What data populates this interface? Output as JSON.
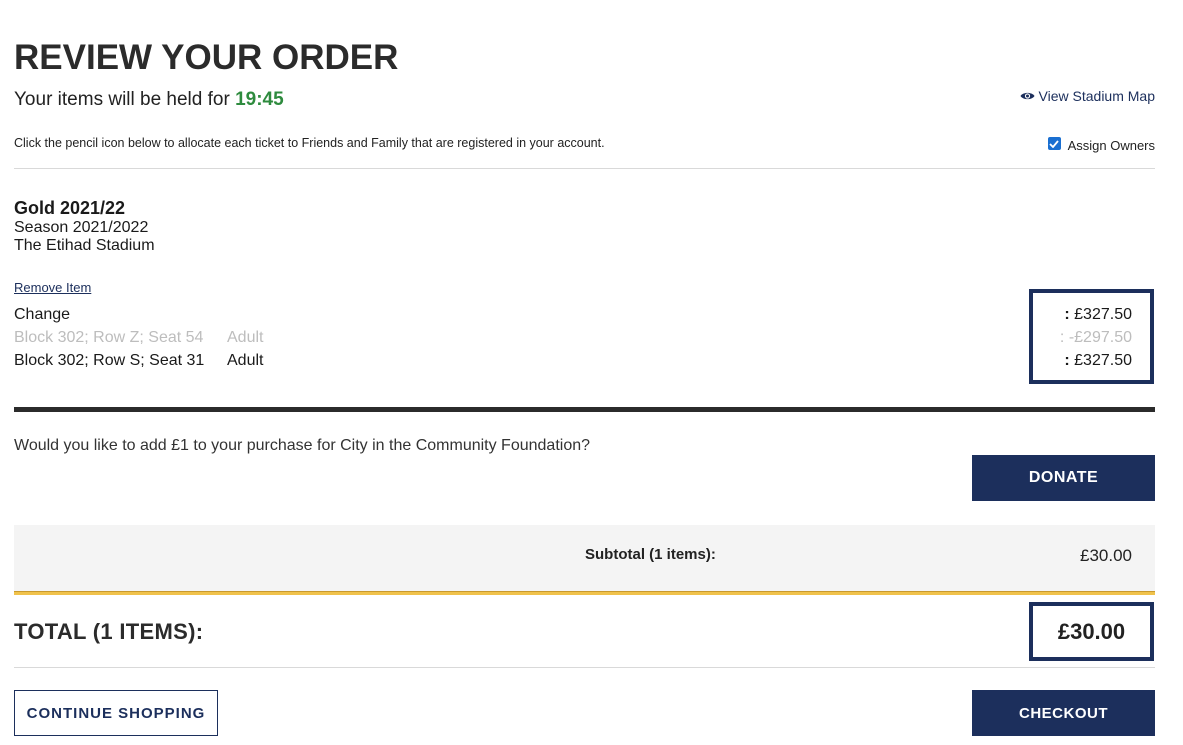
{
  "header": {
    "title": "REVIEW YOUR ORDER",
    "hold_text": "Your items will be held for",
    "hold_timer": "19:45",
    "view_map_label": "View Stadium Map",
    "instructions": "Click the pencil icon below to allocate each ticket to Friends and Family that are registered in your account.",
    "assign_owners_label": "Assign Owners",
    "assign_owners_checked": true
  },
  "item": {
    "name": "Gold 2021/22",
    "season": "Season 2021/2022",
    "venue": "The Etihad Stadium",
    "remove_label": "Remove Item",
    "change_label": "Change",
    "lines": [
      {
        "seat": "Block 302; Row Z; Seat 54",
        "type": "Adult",
        "price_prefix": ":",
        "price": "-£297.50",
        "muted": true
      },
      {
        "seat": "Block 302; Row S; Seat 31",
        "type": "Adult",
        "price_prefix": ":",
        "price": "£327.50",
        "muted": false
      }
    ],
    "change_price_prefix": ":",
    "change_price": "£327.50"
  },
  "donation": {
    "question": "Would you like to add £1 to your purchase for City in the Community Foundation?",
    "button_label": "DONATE"
  },
  "summary": {
    "subtotal_label": "Subtotal (1 items):",
    "subtotal_value": "£30.00",
    "total_label": "TOTAL (1 ITEMS):",
    "total_value": "£30.00"
  },
  "actions": {
    "continue_label": "CONTINUE SHOPPING",
    "checkout_label": "CHECKOUT"
  },
  "colors": {
    "navy": "#1c2f5c",
    "timer_green": "#2e8b3e",
    "gold_rule": "#f0c24b",
    "checkbox_blue": "#1a6fd1"
  }
}
